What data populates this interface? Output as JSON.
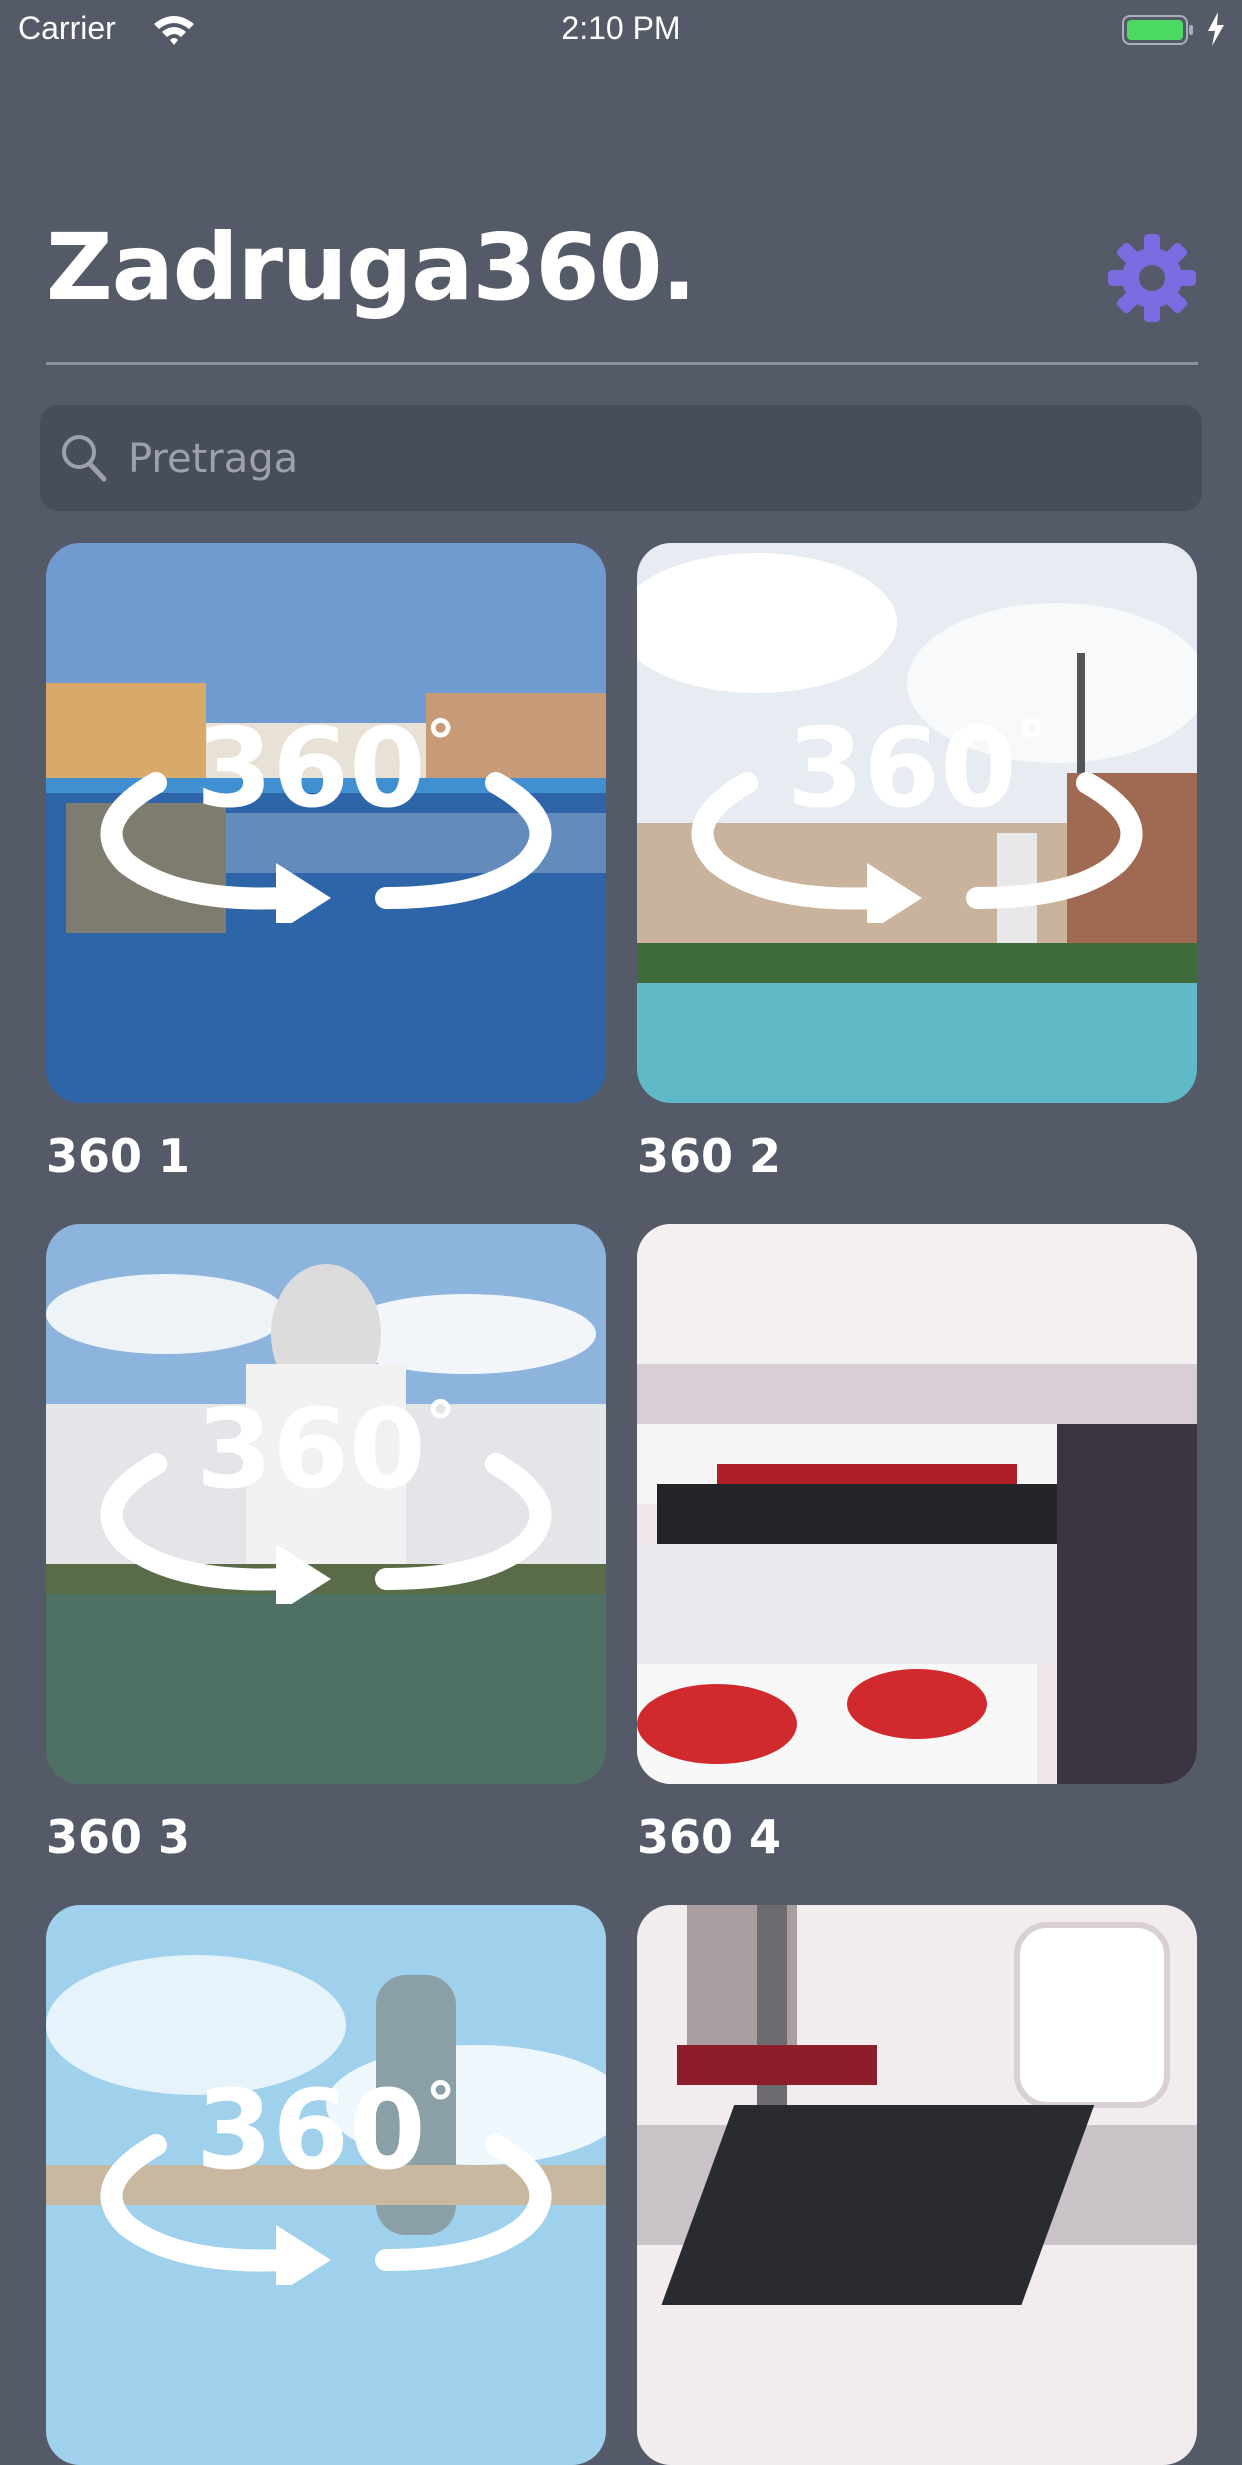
{
  "status_bar": {
    "carrier": "Carrier",
    "time": "2:10 PM",
    "battery_color": "#4cd964"
  },
  "header": {
    "title": "Zadruga360.",
    "settings_icon": "gear-icon",
    "accent_color": "#7b6be0"
  },
  "search": {
    "placeholder": "Pretraga",
    "value": ""
  },
  "grid": {
    "items": [
      {
        "label": "360 1",
        "badge": "360",
        "badge_degree": "°"
      },
      {
        "label": "360 2",
        "badge": "360",
        "badge_degree": "°"
      },
      {
        "label": "360 3",
        "badge": "360",
        "badge_degree": "°"
      },
      {
        "label": "360 4"
      },
      {
        "label": "",
        "badge": "360",
        "badge_degree": "°"
      },
      {
        "label": ""
      }
    ]
  }
}
